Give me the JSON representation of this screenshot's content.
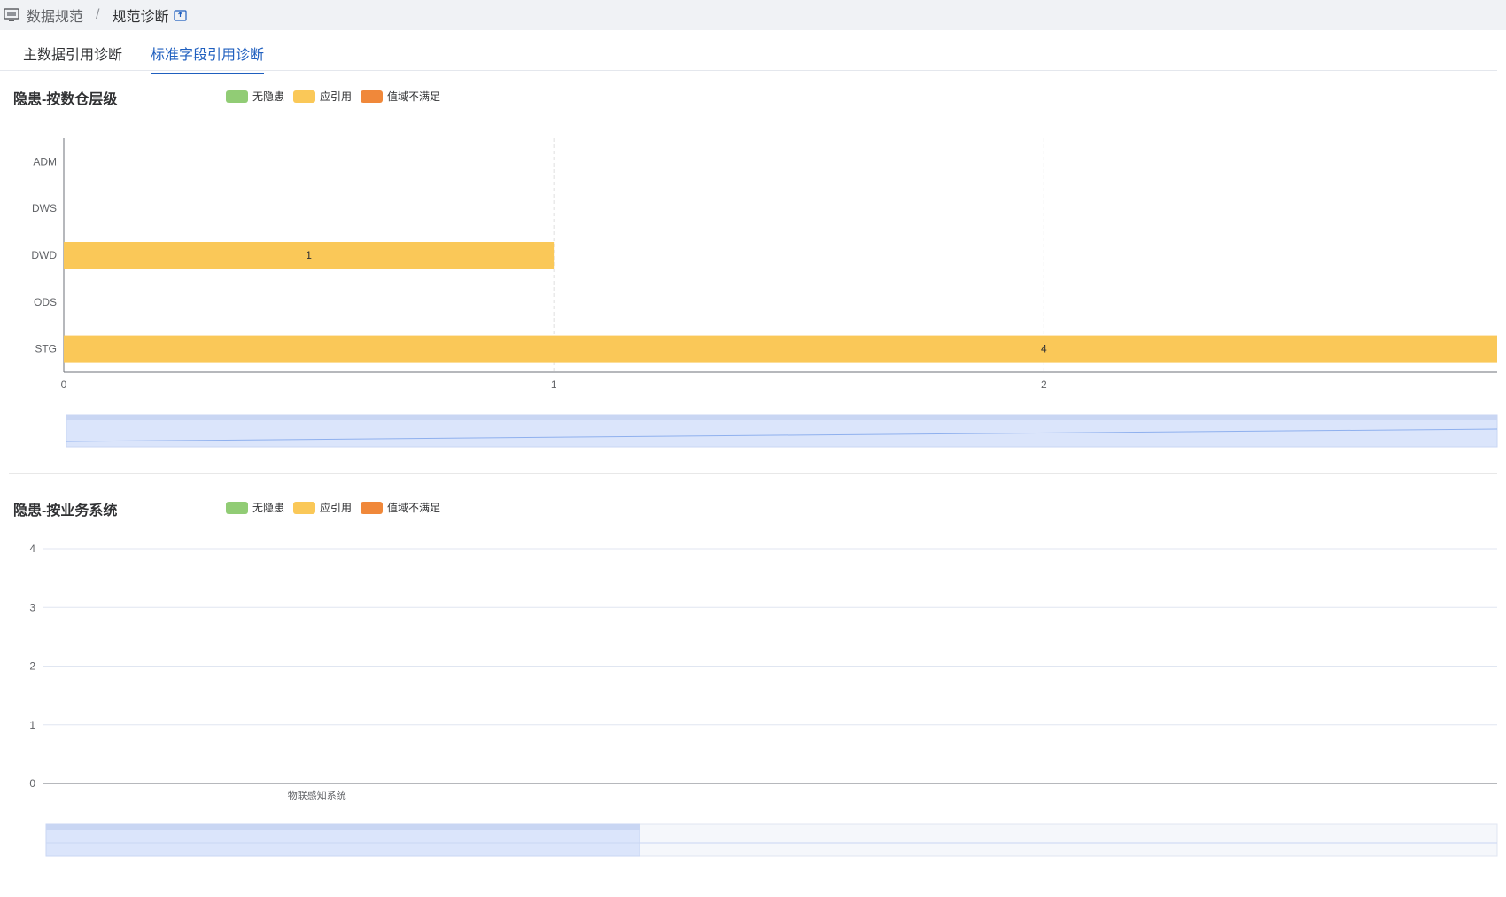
{
  "breadcrumb": {
    "icon": "monitor-icon",
    "parent": "数据规范",
    "separator": "/",
    "current": "规范诊断",
    "external_icon": "external-link-icon"
  },
  "tabs": [
    {
      "label": "主数据引用诊断",
      "active": false
    },
    {
      "label": "标准字段引用诊断",
      "active": true
    }
  ],
  "colors": {
    "no_risk": "#91cc75",
    "should_ref": "#fac858",
    "domain_unmet": "#f0883a",
    "accent": "#1f5fbf",
    "zoom_fill": "#dbe5fb"
  },
  "legend": [
    {
      "label": "无隐患",
      "color": "#91cc75"
    },
    {
      "label": "应引用",
      "color": "#fac858"
    },
    {
      "label": "值域不满足",
      "color": "#f0883a"
    }
  ],
  "chart_data": [
    {
      "type": "bar",
      "orientation": "horizontal",
      "title": "隐患-按数仓层级",
      "categories": [
        "ADM",
        "DWS",
        "DWD",
        "ODS",
        "STG"
      ],
      "series": [
        {
          "name": "无隐患",
          "values": [
            0,
            0,
            0,
            0,
            0
          ]
        },
        {
          "name": "应引用",
          "values": [
            0,
            0,
            1,
            0,
            4
          ]
        },
        {
          "name": "值域不满足",
          "values": [
            0,
            0,
            0,
            0,
            0
          ]
        }
      ],
      "x_ticks": [
        "0",
        "1",
        "2"
      ],
      "xlim": [
        0,
        2.925
      ],
      "grid": true,
      "legend_position": "top-left",
      "data_zoom": true
    },
    {
      "type": "bar",
      "orientation": "vertical",
      "title": "隐患-按业务系统",
      "categories": [
        "物联感知系统"
      ],
      "series": [
        {
          "name": "无隐患",
          "values": [
            0
          ]
        },
        {
          "name": "应引用",
          "values": [
            0
          ]
        },
        {
          "name": "值域不满足",
          "values": [
            0
          ]
        }
      ],
      "y_ticks": [
        "0",
        "1",
        "2",
        "3",
        "4"
      ],
      "ylim": [
        0,
        4
      ],
      "grid": true,
      "legend_position": "top-left",
      "data_zoom": true
    }
  ]
}
